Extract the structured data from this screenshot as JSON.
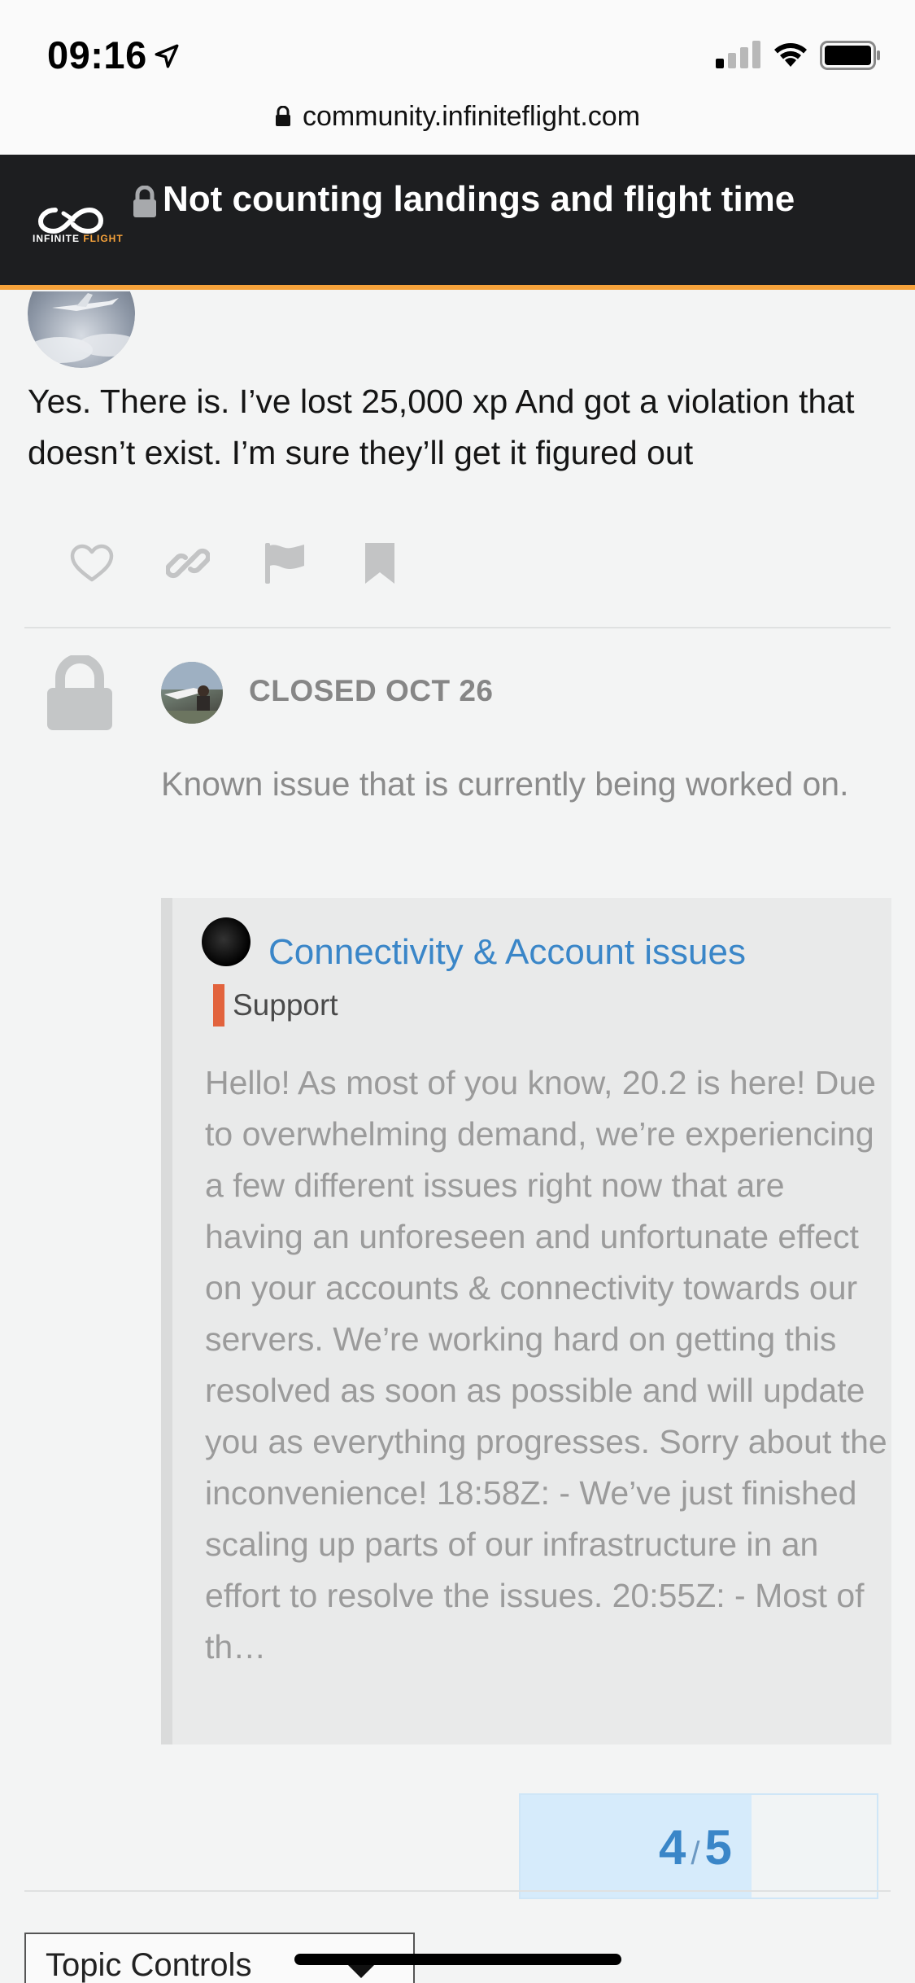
{
  "status_bar": {
    "time": "09:16",
    "url": "community.infiniteflight.com"
  },
  "header": {
    "logo_text_1": "INFINITE",
    "logo_text_2": "FLIGHT",
    "topic_title": "Not counting landings and flight time"
  },
  "post": {
    "body": "Yes. There is. I’ve lost 25,000 xp And got a violation that doesn’t exist. I’m sure they’ll get it figured out",
    "actions": [
      "like-icon",
      "link-icon",
      "flag-icon",
      "bookmark-icon"
    ]
  },
  "closed_action": {
    "label": "CLOSED OCT 26",
    "text": "Known issue that is currently being worked on."
  },
  "onebox": {
    "title": "Connectivity & Account issues",
    "category": "Support",
    "category_color": "#e2633d",
    "excerpt": "Hello! As most of you know, 20.2 is here! Due to overwhelming demand, we’re experiencing a few different issues right now that are having an unforeseen and unfortunate effect on your accounts & connectivity towards our servers. We’re working hard on getting this resolved as soon as possible and will update you as everything progresses. Sorry about the inconvenience! 18:58Z: - We’ve just finished scaling up parts of our infrastructure in an effort to resolve the issues. 20:55Z: - Most of th…"
  },
  "progress": {
    "current": "4",
    "separator": "/",
    "total": "5"
  },
  "topic_controls": {
    "label": "Topic Controls"
  },
  "colors": {
    "header_bg": "#1d1e20",
    "accent_orange": "#f6a23a",
    "link_blue": "#3a86c8"
  }
}
